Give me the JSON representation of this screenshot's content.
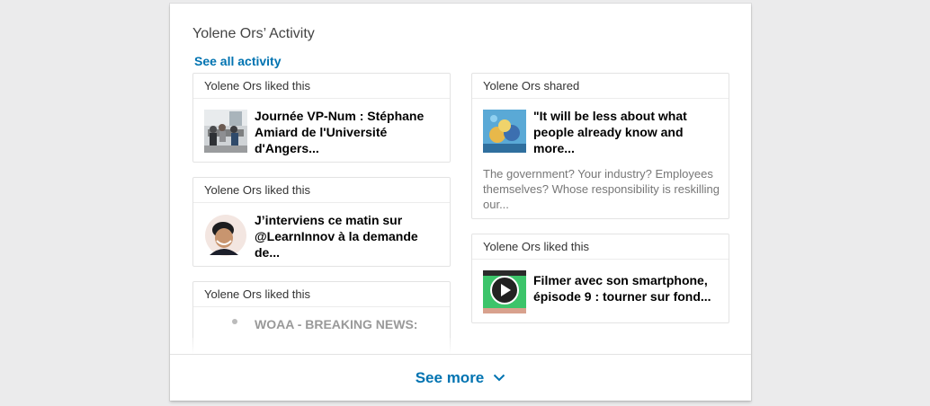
{
  "activity": {
    "title": "Yolene Ors’ Activity",
    "see_all_label": "See all activity",
    "left_cards": [
      {
        "header": "Yolene Ors liked this",
        "title": "Journée VP-Num : Stéphane Amiard de l'Université d'Angers..."
      },
      {
        "header": "Yolene Ors liked this",
        "title": "J’interviens ce matin sur @LearnInnov à la demande de..."
      },
      {
        "header": "Yolene Ors liked this",
        "title": "WOAA - BREAKING NEWS:"
      }
    ],
    "right_cards": [
      {
        "header": "Yolene Ors shared",
        "title": "\"It will be less about what people already know and more...",
        "description": "The government? Your industry? Employees themselves? Whose responsibility is reskilling our..."
      },
      {
        "header": "Yolene Ors liked this",
        "title": "Filmer avec son smartphone, épisode 9 : tourner sur fond..."
      }
    ],
    "see_more_label": "See more"
  },
  "colors": {
    "accent": "#0073b1",
    "background": "#ebebec"
  },
  "icons": [
    "chevron-down-icon",
    "play-icon"
  ]
}
